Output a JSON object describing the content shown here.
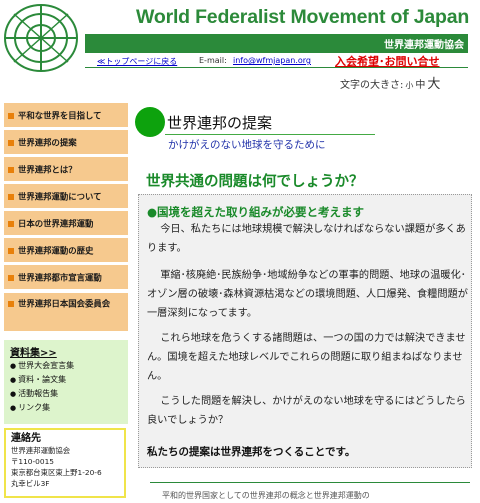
{
  "header": {
    "site_title": "World Federalist Movement of Japan",
    "subtitle": "世界連邦運動協会",
    "home_link": "≪トップページに戻る",
    "email_label": "E-mail:",
    "email": "info@wfmjapan.org",
    "join_link": "入会希望･お問い合せ",
    "font_size": {
      "label": "文字の大きさ:",
      "small": "小",
      "medium": "中",
      "large": "大"
    }
  },
  "nav": {
    "items": [
      {
        "label": "平和な世界を目指して"
      },
      {
        "label": "世界連邦の提案"
      },
      {
        "label": "世界連邦とは？"
      },
      {
        "label": "世界連邦運動について"
      },
      {
        "label": "日本の世界連邦運動"
      },
      {
        "label": "世界連邦運動の歴史"
      },
      {
        "label": "世界連邦都市宣言運動"
      },
      {
        "label": "世界連邦日本国会委員会"
      }
    ]
  },
  "resources": {
    "title": "資料集>>",
    "items": [
      "世界大会宣言集",
      "資料・論文集",
      "活動報告集",
      "リンク集"
    ]
  },
  "contact": {
    "title": "連絡先",
    "lines": [
      "世界連邦運動協会",
      "〒110-0015",
      "東京都台東区東上野1-20-6",
      "丸幸ビル3F"
    ]
  },
  "main": {
    "heading": "世界連邦の提案",
    "subheading": "かけがえのない地球を守るために",
    "question": "世界共通の問題は何でしょうか？",
    "lead": "●国境を超えた取り組みが必要と考えます",
    "paragraphs": [
      "今日、私たちには地球規模で解決しなければならない課題が多くあります。",
      "軍縮･核廃絶･民族紛争･地域紛争などの軍事的問題、地球の温暖化･オゾン層の破壊･森林資源枯渇などの環境問題、人口爆発、食糧問題が一層深刻になってます。",
      "これら地球を危うくする諸問題は、一つの国の力では解決できません。国境を超えた地球レベルでこれらの問題に取り組まねばなりません。",
      "こうした問題を解決し、かけがえのない地球を守るにはどうしたら良いでしょうか？"
    ],
    "conclusion": "私たちの提案は世界連邦をつくることです。",
    "bottom_text": "平和的世界国家としての世界連邦の概念と世界連邦運動の"
  }
}
